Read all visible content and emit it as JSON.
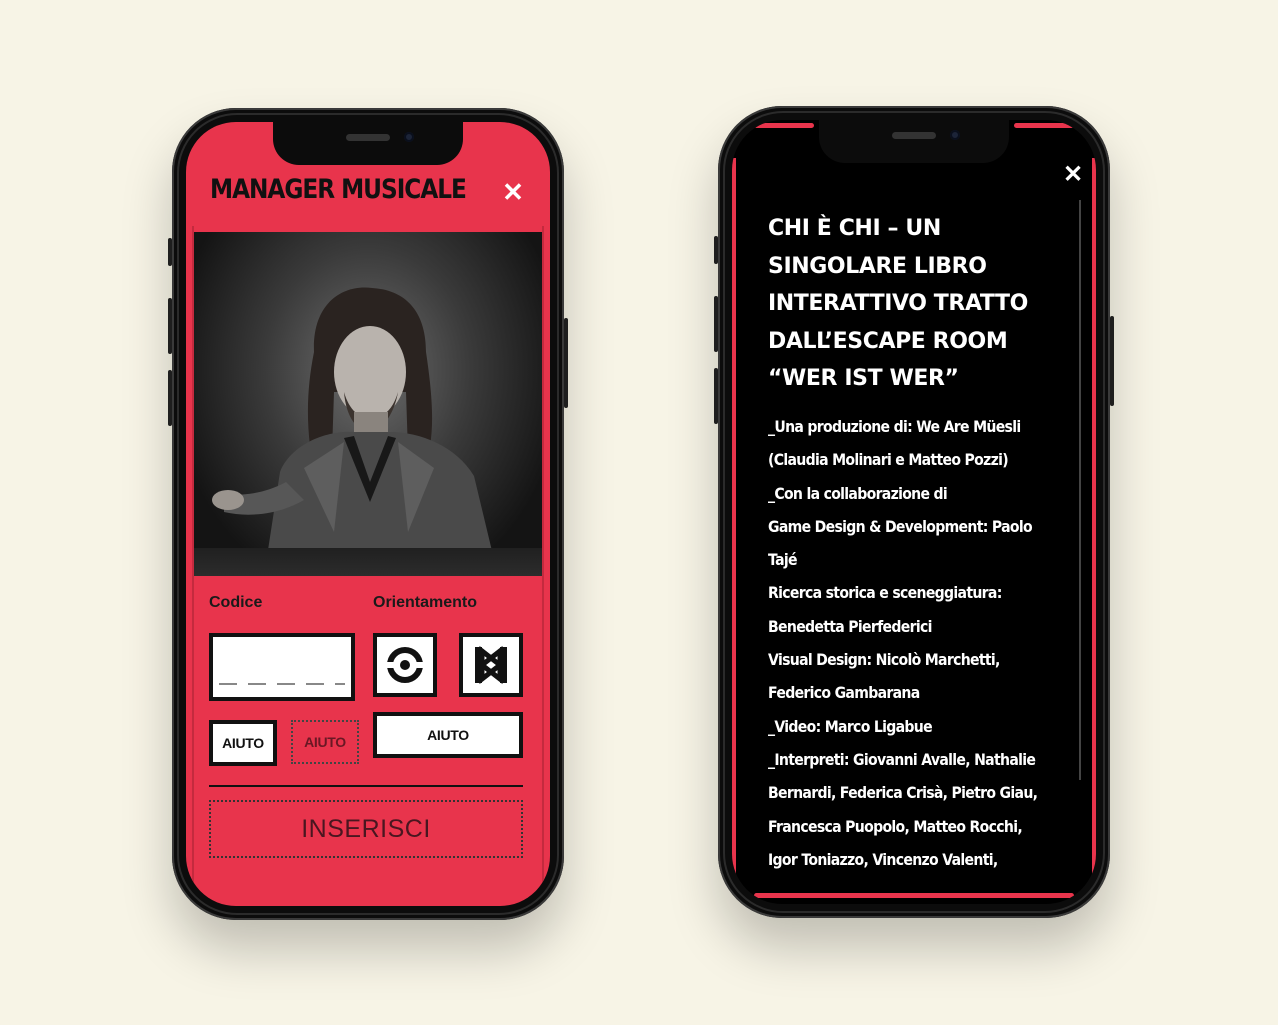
{
  "left_screen": {
    "title": "MANAGER MUSICALE",
    "close_glyph": "✕",
    "code_label": "Codice",
    "orientation_label": "Orientamento",
    "help_button_1": "AIUTO",
    "help_button_2": "AIUTO",
    "help_button_3": "AIUTO",
    "insert_button": "INSERISCI",
    "accent_color": "#e8344c"
  },
  "right_screen": {
    "close_glyph": "✕",
    "title_lines": [
      "CHI È CHI – UN",
      "SINGOLARE LIBRO",
      "INTERATTIVO TRATTO",
      "DALL’ESCAPE ROOM",
      "“WER IST WER”"
    ],
    "credit_lines": [
      "_Una produzione di: We Are Müesli",
      "(Claudia Molinari e Matteo Pozzi)",
      "_Con la collaborazione di",
      "Game Design & Development: Paolo",
      "Tajé",
      "Ricerca storica e sceneggiatura:",
      "Benedetta Pierfederici",
      "Visual Design: Nicolò Marchetti,",
      "Federico Gambarana",
      "_Video: Marco Ligabue",
      "_Interpreti: Giovanni Avalle, Nathalie",
      "Bernardi, Federica Crisà, Pietro Giau,",
      "Francesca Puopolo, Matteo Rocchi,",
      "Igor Toniazzo, Vincenzo Valenti,"
    ]
  }
}
